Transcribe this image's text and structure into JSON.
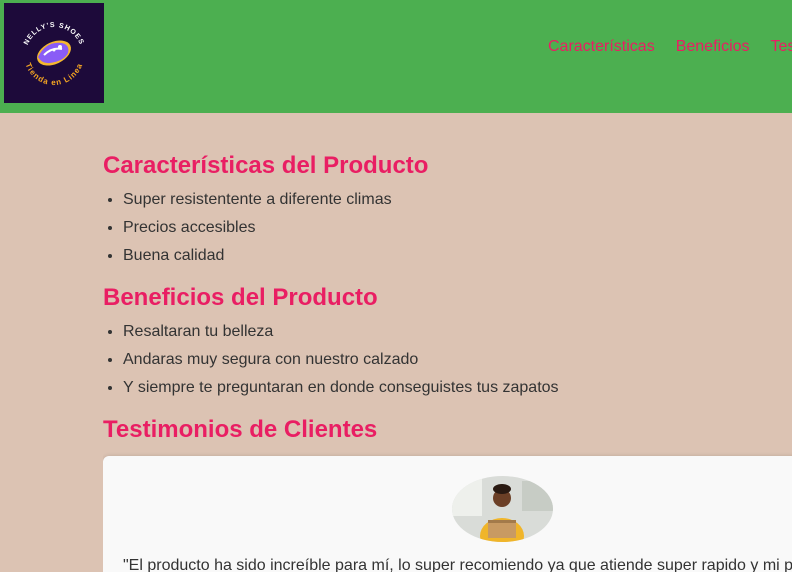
{
  "logo": {
    "line1": "NELLY'S SHOES",
    "line2": "Tienda en Linea"
  },
  "nav": {
    "items": [
      "Características",
      "Beneficios",
      "Testimonios"
    ]
  },
  "features": {
    "title": "Características del Producto",
    "items": [
      "Super resistentente a diferente climas",
      "Precios accesibles",
      "Buena calidad"
    ]
  },
  "benefits": {
    "title": "Beneficios del Producto",
    "items": [
      "Resaltaran tu belleza",
      "Andaras muy segura con nuestro calzado",
      "Y siempre te preguntaran en donde conseguistes tus zapatos"
    ]
  },
  "testimonials": {
    "title": "Testimonios de Clientes",
    "quote": "\"El producto ha sido increíble para mí, lo super recomiendo ya que atiende super rapido y mi pedido llegó a tiempo\""
  },
  "colors": {
    "header": "#4caf50",
    "accent": "#e91e63",
    "background": "#dcc3b3",
    "logo_bg": "#1d0a3a"
  }
}
